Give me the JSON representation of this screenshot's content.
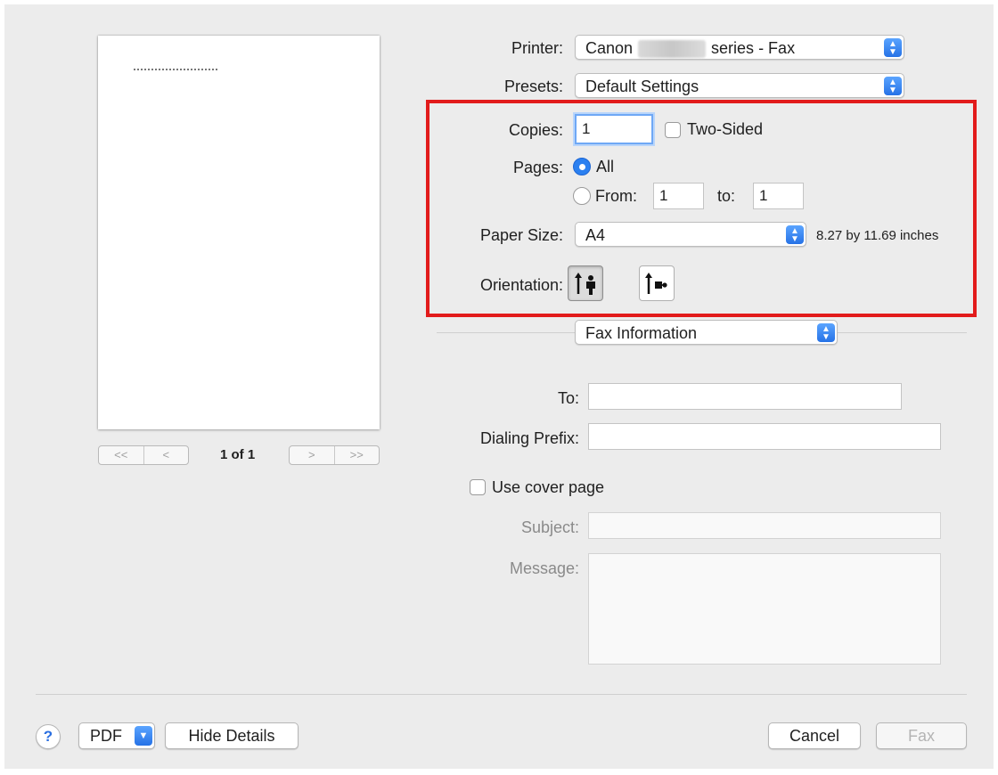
{
  "printer": {
    "label": "Printer:",
    "value_prefix": "Canon",
    "value_suffix": "series - Fax"
  },
  "presets": {
    "label": "Presets:",
    "value": "Default Settings"
  },
  "copies": {
    "label": "Copies:",
    "value": "1",
    "two_sided_label": "Two-Sided"
  },
  "pages": {
    "label": "Pages:",
    "all_label": "All",
    "from_label": "From:",
    "from_value": "1",
    "to_label": "to:",
    "to_value": "1"
  },
  "paper_size": {
    "label": "Paper Size:",
    "value": "A4",
    "dimensions": "8.27 by 11.69 inches"
  },
  "orientation": {
    "label": "Orientation:"
  },
  "section_popup": {
    "value": "Fax Information"
  },
  "fax": {
    "to_label": "To:",
    "to_value": "",
    "dialing_prefix_label": "Dialing Prefix:",
    "dialing_prefix_value": "",
    "cover_page_label": "Use cover page",
    "subject_label": "Subject:",
    "subject_value": "",
    "message_label": "Message:"
  },
  "preview": {
    "nav_first": "<<",
    "nav_prev": "<",
    "page_count": "1 of 1",
    "nav_next": ">",
    "nav_last": ">>"
  },
  "footer": {
    "help": "?",
    "pdf_label": "PDF",
    "hide_details_label": "Hide Details",
    "cancel_label": "Cancel",
    "fax_label": "Fax"
  },
  "colors": {
    "accent": "#2b80f0",
    "highlight_box": "#e21b1b"
  }
}
